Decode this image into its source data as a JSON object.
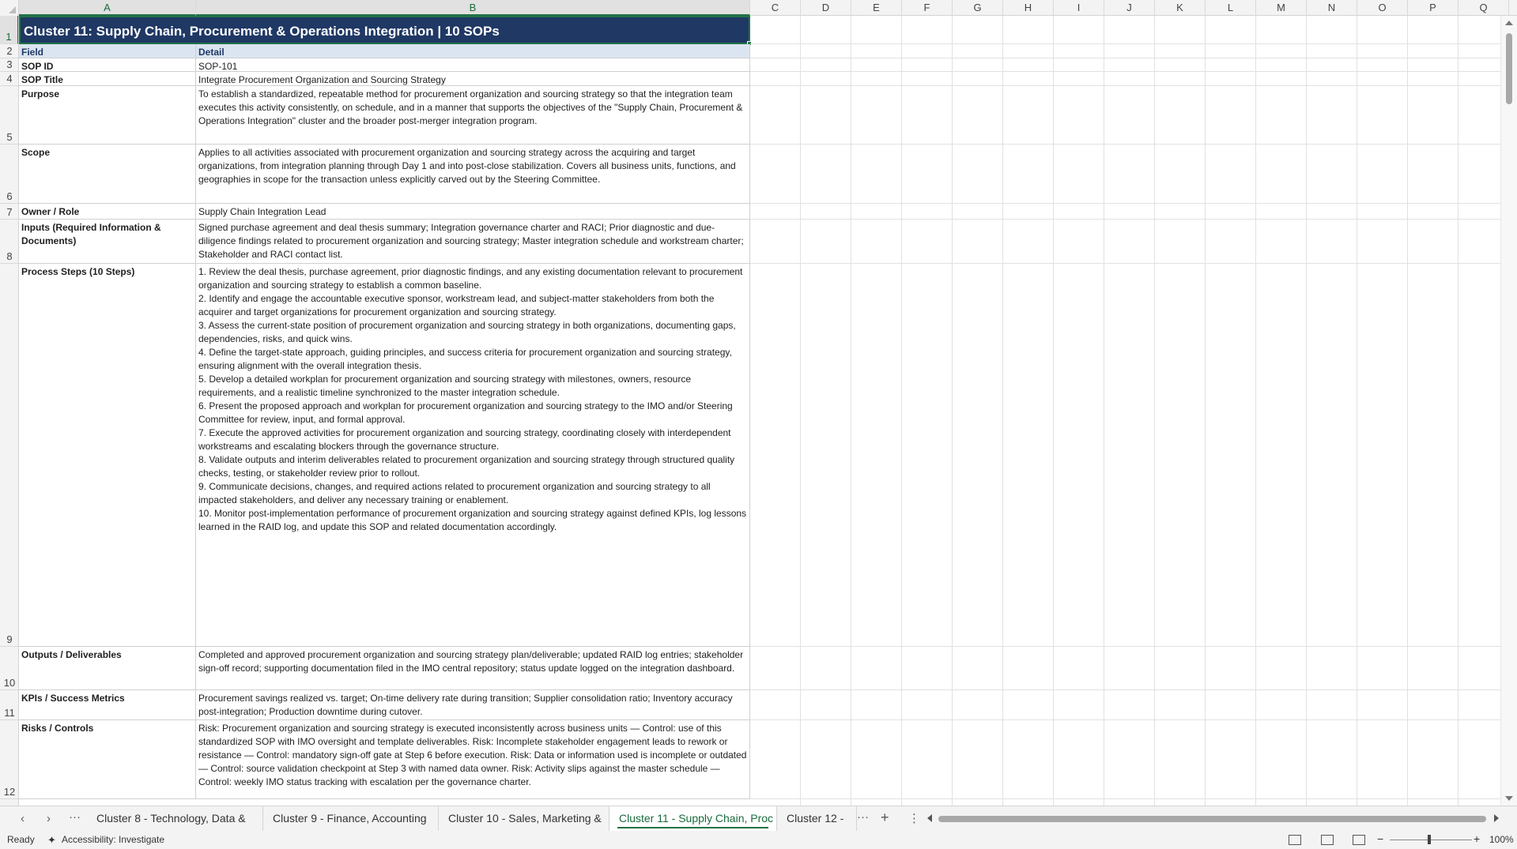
{
  "columns": [
    "A",
    "B",
    "C",
    "D",
    "E",
    "F",
    "G",
    "H",
    "I",
    "J",
    "K",
    "L",
    "M",
    "N",
    "O",
    "P",
    "Q"
  ],
  "rows": [
    "1",
    "2",
    "3",
    "4",
    "5",
    "6",
    "7",
    "8",
    "9",
    "10",
    "11",
    "12"
  ],
  "title": "Cluster 11: Supply Chain, Procurement & Operations Integration  |  10 SOPs",
  "header": {
    "field": "Field",
    "detail": "Detail"
  },
  "records": [
    {
      "field": "SOP ID",
      "detail": "SOP-101"
    },
    {
      "field": "SOP Title",
      "detail": "Integrate Procurement Organization and Sourcing Strategy"
    },
    {
      "field": "Purpose",
      "detail": "To establish a standardized, repeatable method for procurement organization and sourcing strategy so that the integration team executes this activity consistently, on schedule, and in a manner that supports the objectives of the \"Supply Chain, Procurement & Operations Integration\" cluster and the broader post-merger integration program."
    },
    {
      "field": "Scope",
      "detail": "Applies to all activities associated with procurement organization and sourcing strategy across the acquiring and target organizations, from integration planning through Day 1 and into post-close stabilization. Covers all business units, functions, and geographies in scope for the transaction unless explicitly carved out by the Steering Committee."
    },
    {
      "field": "Owner / Role",
      "detail": "Supply Chain Integration Lead"
    },
    {
      "field": "Inputs (Required Information & Documents)",
      "detail": "Signed purchase agreement and deal thesis summary; Integration governance charter and RACI; Prior diagnostic and due-diligence findings related to procurement organization and sourcing strategy; Master integration schedule and workstream charter; Stakeholder and RACI contact list."
    },
    {
      "field": "Process Steps (10 Steps)",
      "detail": "1. Review the deal thesis, purchase agreement, prior diagnostic findings, and any existing documentation relevant to procurement organization and sourcing strategy to establish a common baseline.\n2. Identify and engage the accountable executive sponsor, workstream lead, and subject-matter stakeholders from both the acquirer and target organizations for procurement organization and sourcing strategy.\n3. Assess the current-state position of procurement organization and sourcing strategy in both organizations, documenting gaps, dependencies, risks, and quick wins.\n4. Define the target-state approach, guiding principles, and success criteria for procurement organization and sourcing strategy, ensuring alignment with the overall integration thesis.\n5. Develop a detailed workplan for procurement organization and sourcing strategy with milestones, owners, resource requirements, and a realistic timeline synchronized to the master integration schedule.\n6. Present the proposed approach and workplan for procurement organization and sourcing strategy to the IMO and/or Steering Committee for review, input, and formal approval.\n7. Execute the approved activities for procurement organization and sourcing strategy, coordinating closely with interdependent workstreams and escalating blockers through the governance structure.\n8. Validate outputs and interim deliverables related to procurement organization and sourcing strategy through structured quality checks, testing, or stakeholder review prior to rollout.\n9. Communicate decisions, changes, and required actions related to procurement organization and sourcing strategy to all impacted stakeholders, and deliver any necessary training or enablement.\n10. Monitor post-implementation performance of procurement organization and sourcing strategy against defined KPIs, log lessons learned in the RAID log, and update this SOP and related documentation accordingly."
    },
    {
      "field": "Outputs / Deliverables",
      "detail": "Completed and approved procurement organization and sourcing strategy plan/deliverable; updated RAID log entries; stakeholder sign-off record; supporting documentation filed in the IMO central repository; status update logged on the integration dashboard."
    },
    {
      "field": "KPIs / Success Metrics",
      "detail": "Procurement savings realized vs. target; On-time delivery rate during transition; Supplier consolidation ratio; Inventory accuracy post-integration; Production downtime during cutover."
    },
    {
      "field": "Risks / Controls",
      "detail": "Risk: Procurement organization and sourcing strategy is executed inconsistently across business units — Control: use of this standardized SOP with IMO oversight and template deliverables. Risk: Incomplete stakeholder engagement leads to rework or resistance — Control: mandatory sign-off gate at Step 6 before execution. Risk: Data or information used is incomplete or outdated — Control: source validation checkpoint at Step 3 with named data owner. Risk: Activity slips against the master schedule — Control: weekly IMO status tracking with escalation per the governance charter."
    }
  ],
  "tabs": {
    "items": [
      "Cluster 8 - Technology, Data &",
      "Cluster 9 - Finance, Accounting",
      "Cluster 10 - Sales, Marketing &",
      "Cluster 11 - Supply Chain, Proc",
      "Cluster 12 -"
    ],
    "active": "Cluster 11 - Supply Chain, Proc",
    "more_label": "···",
    "add_label": "+",
    "options_label": "⋮"
  },
  "status": {
    "ready": "Ready",
    "accessibility": "Accessibility: Investigate",
    "zoom": "100%",
    "zoom_minus": "−",
    "zoom_plus": "+"
  },
  "colors": {
    "title_bg": "#1f3864",
    "header_bg": "#dbe5f1",
    "selection": "#217346"
  }
}
